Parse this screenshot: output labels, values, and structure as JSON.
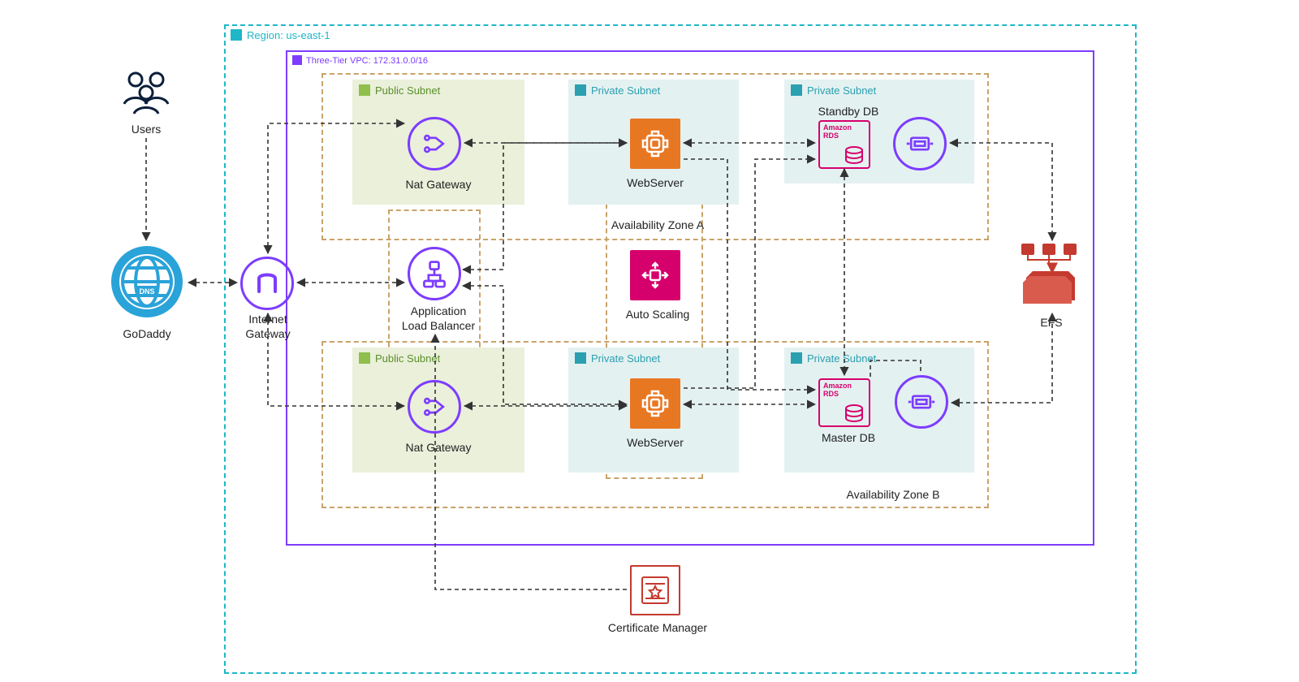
{
  "region": {
    "label": "Region: us-east-1"
  },
  "vpc": {
    "label": "Three-Tier VPC: 172.31.0.0/16"
  },
  "az": {
    "a_label": "Availability Zone A",
    "b_label": "Availability Zone B"
  },
  "subnet": {
    "public_label": "Public Subnet",
    "private_label": "Private Subnet"
  },
  "nodes": {
    "users": "Users",
    "godaddy": "GoDaddy",
    "igw": "Internet\nGateway",
    "alb": "Application\nLoad Balancer",
    "nat": "Nat Gateway",
    "webserver": "WebServer",
    "autoscaling": "Auto Scaling",
    "standby_db": "Standby DB",
    "master_db": "Master DB",
    "efs": "EFS",
    "cert_manager": "Certificate Manager"
  },
  "rds_badge": "Amazon\nRDS"
}
